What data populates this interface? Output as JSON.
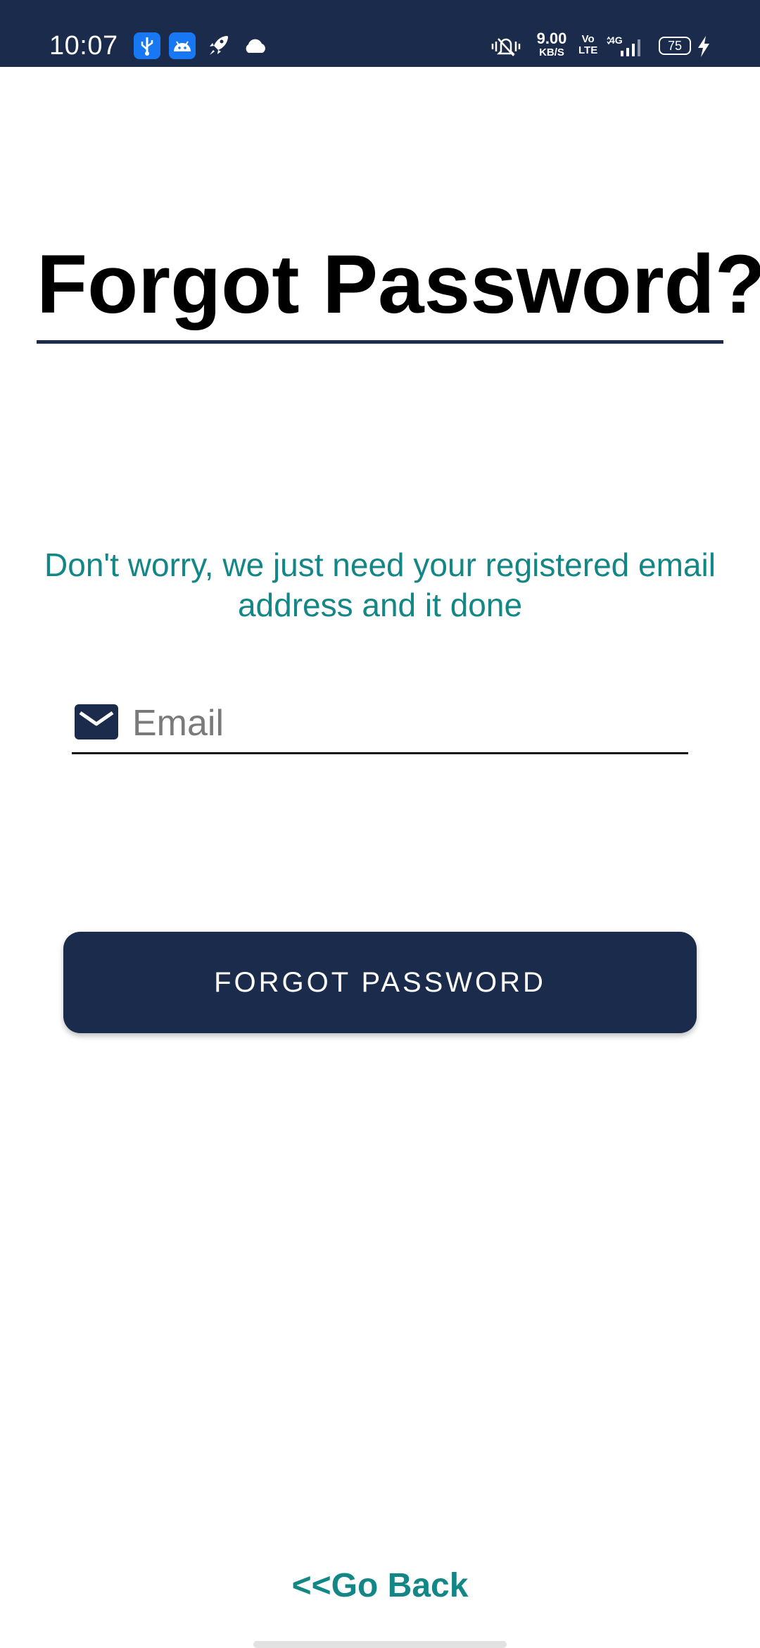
{
  "status_bar": {
    "time": "10:07",
    "network_speed_value": "9.00",
    "network_speed_unit": "KB/S",
    "volte_top": "Vo",
    "volte_bottom": "LTE",
    "network_type": "4G",
    "battery_level": "75",
    "notification_icons": [
      "usb-icon",
      "android-icon",
      "rocket-icon",
      "cloud-icon"
    ],
    "background_color": "#1a2b4c"
  },
  "main": {
    "title": "Forgot Password?",
    "subtitle": "Don't worry, we just need your registered email address and it done",
    "email_field": {
      "placeholder": "Email",
      "value": "",
      "icon": "mail-icon"
    },
    "submit_label": "FORGOT PASSWORD",
    "go_back_label": "<<Go Back"
  },
  "colors": {
    "primary": "#1a2b4c",
    "accent_teal": "#138686",
    "title_text": "#000000"
  }
}
